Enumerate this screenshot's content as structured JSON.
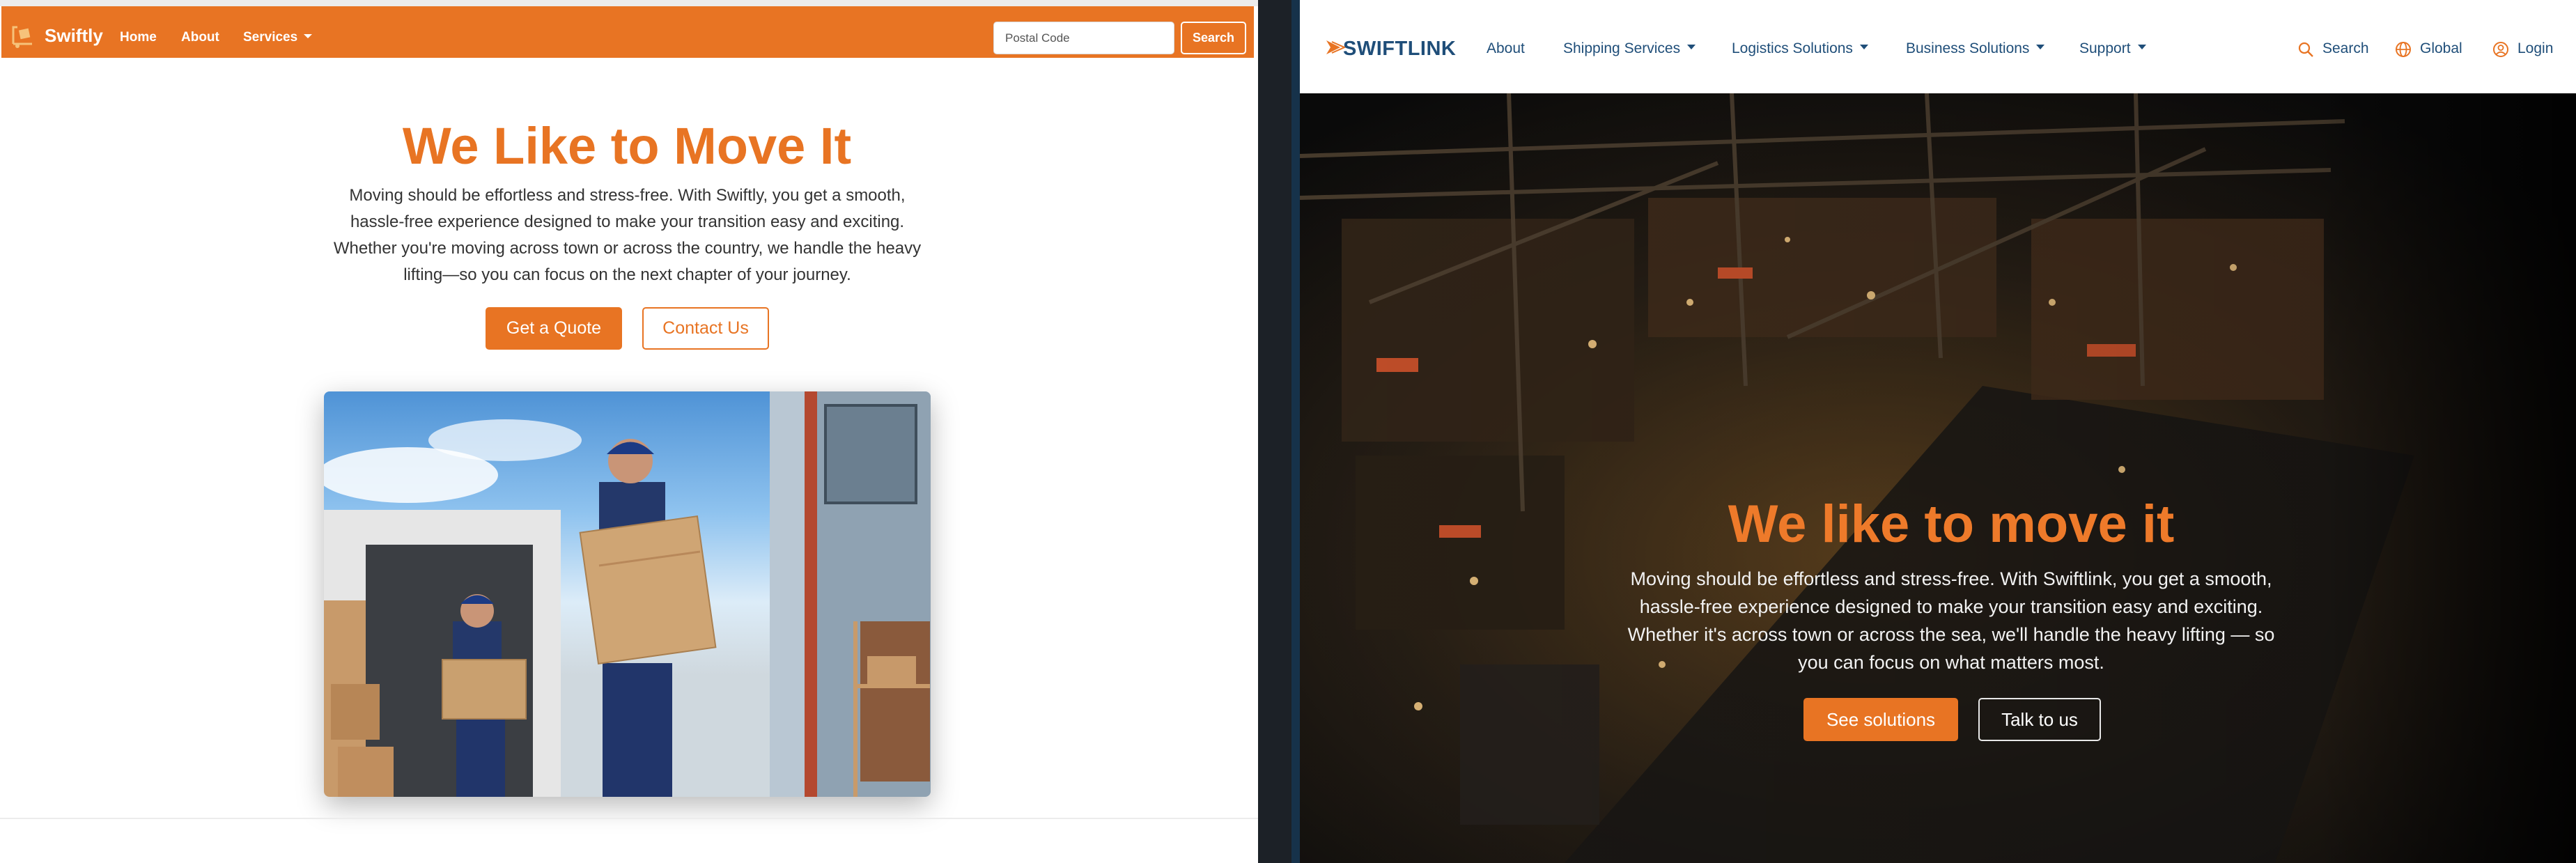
{
  "swiftly": {
    "brand": "Swiftly",
    "nav": {
      "home": "Home",
      "about": "About",
      "services": "Services"
    },
    "postal_placeholder": "Postal Code",
    "search_label": "Search",
    "hero": {
      "title": "We Like to Move It",
      "text": "Moving should be effortless and stress-free. With Swiftly, you get a smooth, hassle-free experience designed to make your transition easy and exciting. Whether you're moving across town or across the country, we handle the heavy lifting—so you can focus on the next chapter of your journey.",
      "primary_cta": "Get a Quote",
      "secondary_cta": "Contact Us"
    },
    "colors": {
      "accent": "#e87423"
    }
  },
  "swiftlink": {
    "brand": "SWIFTLINK",
    "nav": {
      "about": "About",
      "shipping": "Shipping Services",
      "logistics": "Logistics Solutions",
      "business": "Business Solutions",
      "support": "Support"
    },
    "utils": {
      "search": "Search",
      "global": "Global",
      "login": "Login"
    },
    "hero": {
      "title": "We like to move it",
      "text": "Moving should be effortless and stress-free. With Swiftlink, you get a smooth, hassle-free experience designed to make your transition easy and exciting. Whether it's across town or across the sea, we'll handle the heavy lifting — so you can focus on what matters most.",
      "primary_cta": "See solutions",
      "secondary_cta": "Talk to us"
    },
    "colors": {
      "accent": "#ee7a2a",
      "brand_blue": "#1f4e79"
    },
    "icons": [
      "search-icon",
      "globe-icon",
      "user-icon"
    ]
  }
}
